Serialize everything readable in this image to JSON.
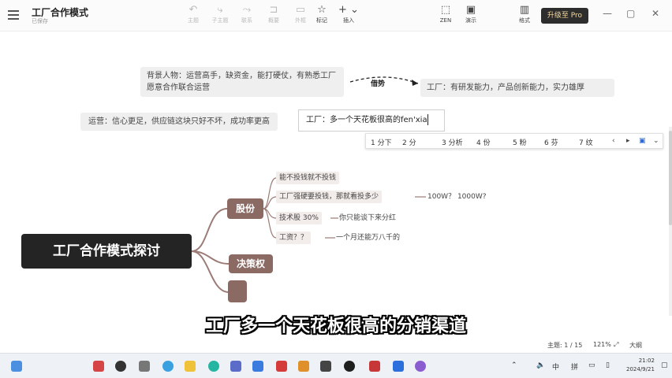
{
  "app": {
    "title": "工厂合作模式",
    "subtitle": "已保存"
  },
  "toolbar": {
    "buttons": [
      {
        "icon": "undo-icon",
        "label": "主题",
        "glyph": "↶"
      },
      {
        "icon": "subtopic-icon",
        "label": "子主题",
        "glyph": "⤷"
      },
      {
        "icon": "link-icon",
        "label": "联系",
        "glyph": "⤳"
      },
      {
        "icon": "summary-icon",
        "label": "概要",
        "glyph": "⊐"
      },
      {
        "icon": "boundary-icon",
        "label": "外框",
        "glyph": "▭"
      },
      {
        "icon": "star-icon",
        "label": "标记",
        "glyph": "☆"
      },
      {
        "icon": "plus-icon",
        "label": "插入",
        "glyph": "+ ⌄"
      },
      {
        "icon": "zen-icon",
        "label": "ZEN",
        "glyph": "⬚"
      },
      {
        "icon": "present-icon",
        "label": "演示",
        "glyph": "▣"
      },
      {
        "icon": "format-icon",
        "label": "格式",
        "glyph": "▥"
      }
    ],
    "upgrade_label": "升级至 Pro"
  },
  "canvas": {
    "notes": {
      "background_person": "背景人物：运营高手，缺资金，能打硬仗，有熟悉工厂愿意合作联合运营",
      "relationship_label": "借势",
      "factory_capability": "工厂：有研发能力，产品创新能力，实力雄厚",
      "operations": "运营：信心更足，供应链这块只好不坏，成功率更高",
      "editing_text": "工厂：多一个天花板很高的fen'xia"
    },
    "ime_candidates": [
      "1 分下",
      "2 分",
      "3 分析",
      "4 份",
      "5 粉",
      "6 芬",
      "7 纹"
    ],
    "mindmap": {
      "root": "工厂合作模式探讨",
      "branches": [
        "股份",
        "决策权",
        ""
      ],
      "leaves": {
        "l1": "能不投钱就不投钱",
        "l2": "工厂强硬要投钱，那就看投多少",
        "l2_child": "100W？ 1000W?",
        "l3": "技术股 30%",
        "l3_child": "你只能谈下来分红",
        "l4": "工资？？",
        "l4_child": "一个月还能万八千的"
      }
    },
    "subtitle": "工厂多一个天花板很高的分销渠道"
  },
  "statusbar": {
    "topic_count": "主题: 1 / 15",
    "zoom": "121%",
    "font_size": "大纲"
  },
  "taskbar": {
    "tray_lang": "中",
    "tray_ime": "拼",
    "time": "21:02",
    "date": "2024/9/21"
  },
  "colors": {
    "root_bg": "#242424",
    "branch_bg": "#8b6a64",
    "leaf_bg": "#f2ecea",
    "connector": "#9b7b76"
  }
}
